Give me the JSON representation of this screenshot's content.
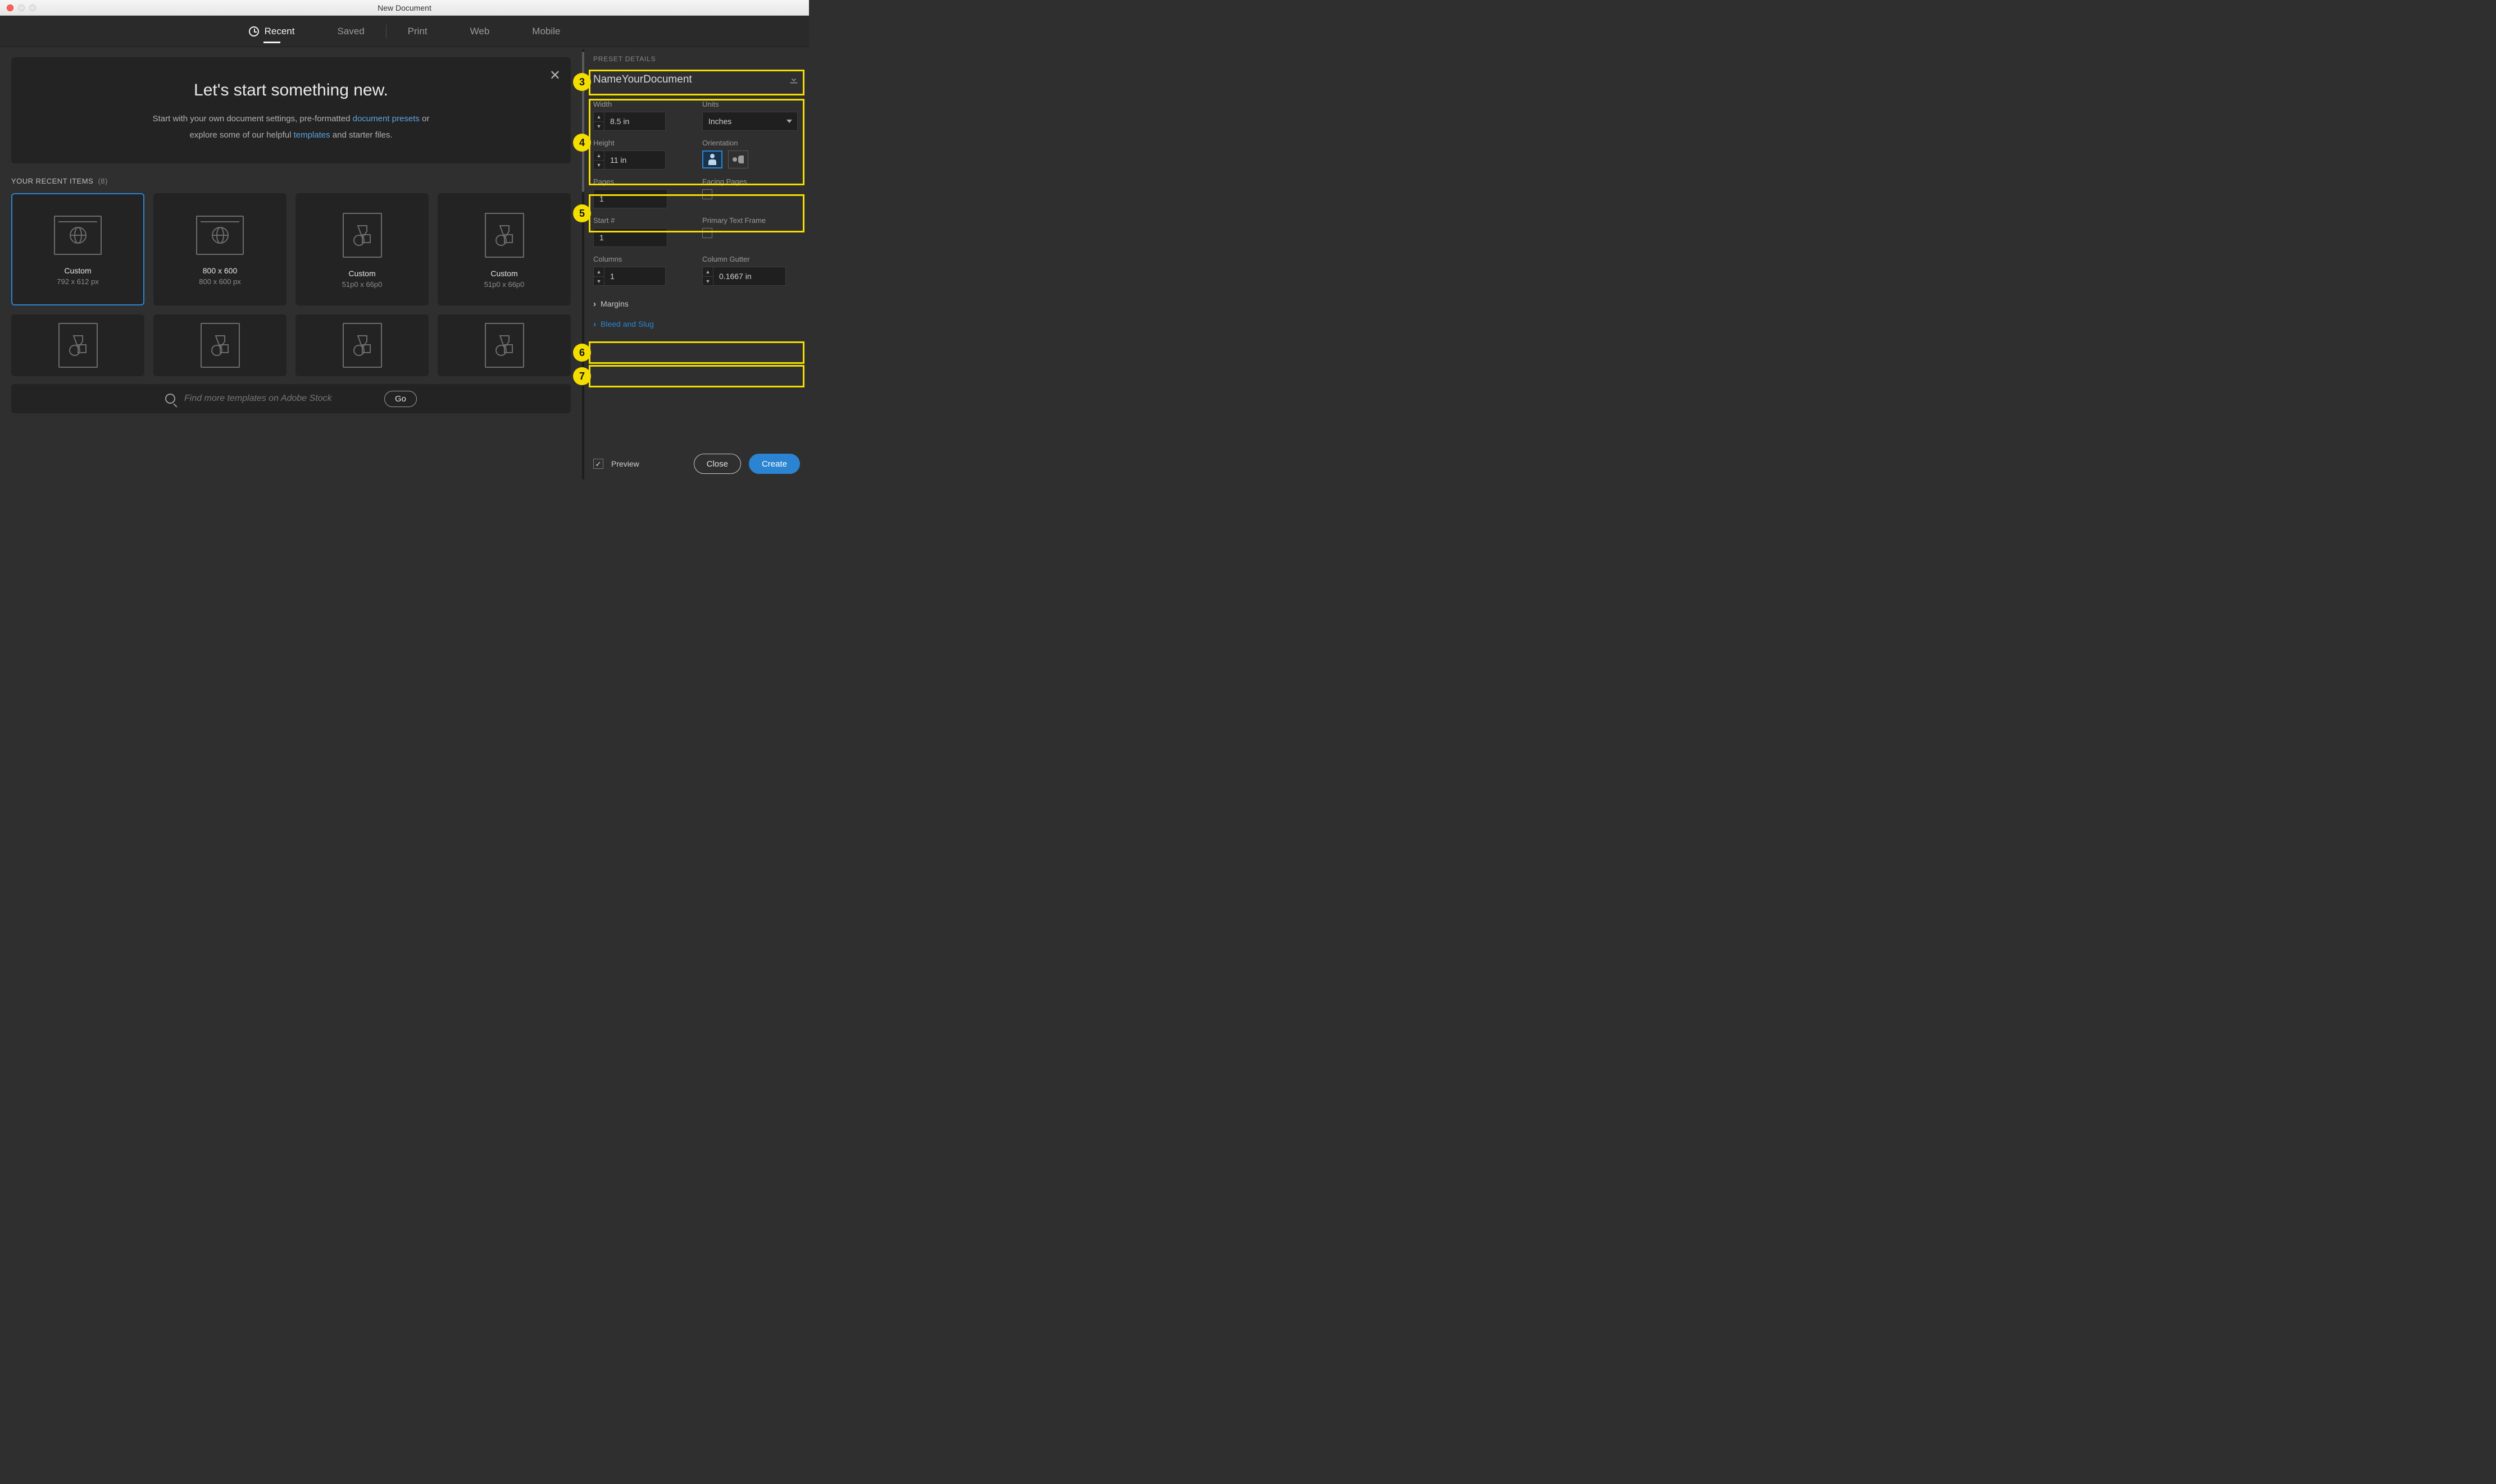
{
  "window": {
    "title": "New Document"
  },
  "tabs": {
    "recent": "Recent",
    "saved": "Saved",
    "print": "Print",
    "web": "Web",
    "mobile": "Mobile"
  },
  "banner": {
    "headline": "Let's start something new.",
    "line1_a": "Start with your own document settings, pre-formatted ",
    "link1": "document presets",
    "line1_b": " or",
    "line2_a": "explore some of our helpful ",
    "link2": "templates",
    "line2_b": " and starter files."
  },
  "recent": {
    "header": "YOUR RECENT ITEMS",
    "count": "(8)",
    "items": [
      {
        "title": "Custom",
        "sub": "792 x 612 px",
        "kind": "globe"
      },
      {
        "title": "800 x 600",
        "sub": "800 x 600 px",
        "kind": "globe"
      },
      {
        "title": "Custom",
        "sub": "51p0 x 66p0",
        "kind": "doc"
      },
      {
        "title": "Custom",
        "sub": "51p0 x 66p0",
        "kind": "doc"
      }
    ]
  },
  "search": {
    "placeholder": "Find more templates on Adobe Stock",
    "go": "Go"
  },
  "preset": {
    "header": "PRESET DETAILS",
    "name": "NameYourDocument",
    "width_label": "Width",
    "width": "8.5 in",
    "units_label": "Units",
    "units": "Inches",
    "height_label": "Height",
    "height": "11 in",
    "orientation_label": "Orientation",
    "pages_label": "Pages",
    "pages": "1",
    "facing_label": "Facing Pages",
    "start_label": "Start #",
    "start": "1",
    "ptf_label": "Primary Text Frame",
    "columns_label": "Columns",
    "columns": "1",
    "gutter_label": "Column Gutter",
    "gutter": "0.1667 in",
    "margins": "Margins",
    "bleed": "Bleed and Slug"
  },
  "footer": {
    "preview": "Preview",
    "close": "Close",
    "create": "Create"
  },
  "annotations": {
    "3": "3",
    "4": "4",
    "5": "5",
    "6": "6",
    "7": "7"
  }
}
